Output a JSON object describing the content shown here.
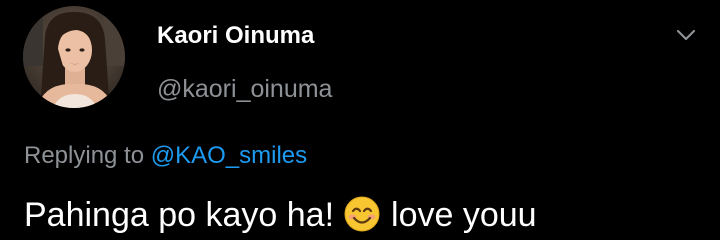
{
  "tweet": {
    "author": {
      "display_name": "Kaori Oinuma",
      "handle": "@kaori_oinuma",
      "avatar": "profile-photo"
    },
    "more_icon": "chevron-down-icon",
    "reply": {
      "prefix": "Replying to ",
      "mention": "@KAO_smiles"
    },
    "text": {
      "before_emoji": "Pahinga po kayo ha!",
      "emoji": "smiling-face-with-smiling-eyes",
      "after_emoji": "love youu"
    }
  },
  "colors": {
    "background": "#000000",
    "primary_text": "#ffffff",
    "secondary_text": "#8e9297",
    "link": "#1d9bf0",
    "emoji_face": "#f8c631"
  }
}
